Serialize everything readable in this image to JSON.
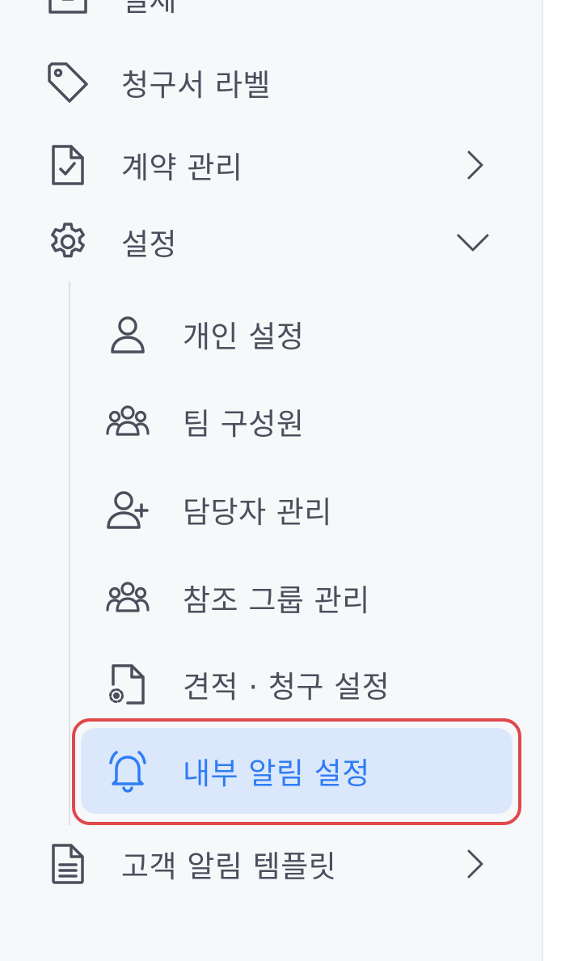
{
  "sidebar": {
    "partial_top": {
      "label": "결제",
      "icon": "inbox-icon"
    },
    "items": [
      {
        "label": "청구서 라벨",
        "icon": "tag-icon"
      },
      {
        "label": "계약 관리",
        "icon": "file-check-icon",
        "chevron": "chevron-right-icon"
      },
      {
        "label": "설정",
        "icon": "gear-icon",
        "chevron": "chevron-down-icon",
        "expanded": true
      },
      {
        "label": "고객 알림 템플릿",
        "icon": "file-text-icon",
        "chevron": "chevron-right-icon"
      }
    ],
    "settings_children": [
      {
        "label": "개인 설정",
        "icon": "user-icon"
      },
      {
        "label": "팀 구성원",
        "icon": "users-icon"
      },
      {
        "label": "담당자 관리",
        "icon": "user-plus-icon"
      },
      {
        "label": "참조 그룹 관리",
        "icon": "users-icon"
      },
      {
        "label": "견적 · 청구 설정",
        "icon": "file-settings-icon"
      },
      {
        "label": "내부 알림 설정",
        "icon": "bell-icon",
        "active": true
      }
    ]
  },
  "colors": {
    "label": "#4a4f5c",
    "icon": "#4a4f5c",
    "active": "#2f7cf6",
    "active_bg": "#dbe8fc",
    "highlight_ring": "#e0484a"
  }
}
